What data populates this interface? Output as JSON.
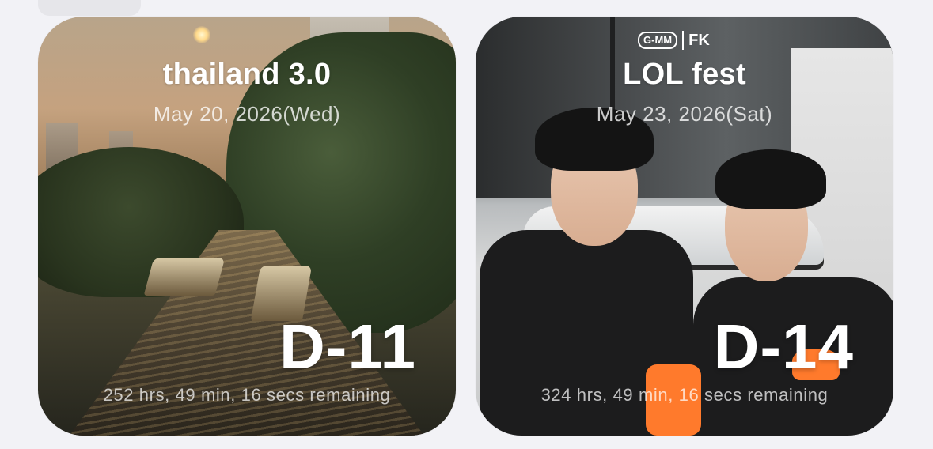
{
  "widgets": [
    {
      "title": "thailand 3.0",
      "date": "May 20, 2026(Wed)",
      "countdown": "D-11",
      "remaining": "252 hrs, 49 min, 16 secs remaining"
    },
    {
      "title": "LOL fest",
      "date": "May 23, 2026(Sat)",
      "countdown": "D-14",
      "remaining": "324 hrs, 49 min, 16 secs remaining",
      "logo_left": "G-MM",
      "logo_right": "FK"
    }
  ],
  "colors": {
    "background": "#f2f2f6",
    "text_primary": "#ffffff",
    "accent_orange": "#ff7a2c"
  }
}
